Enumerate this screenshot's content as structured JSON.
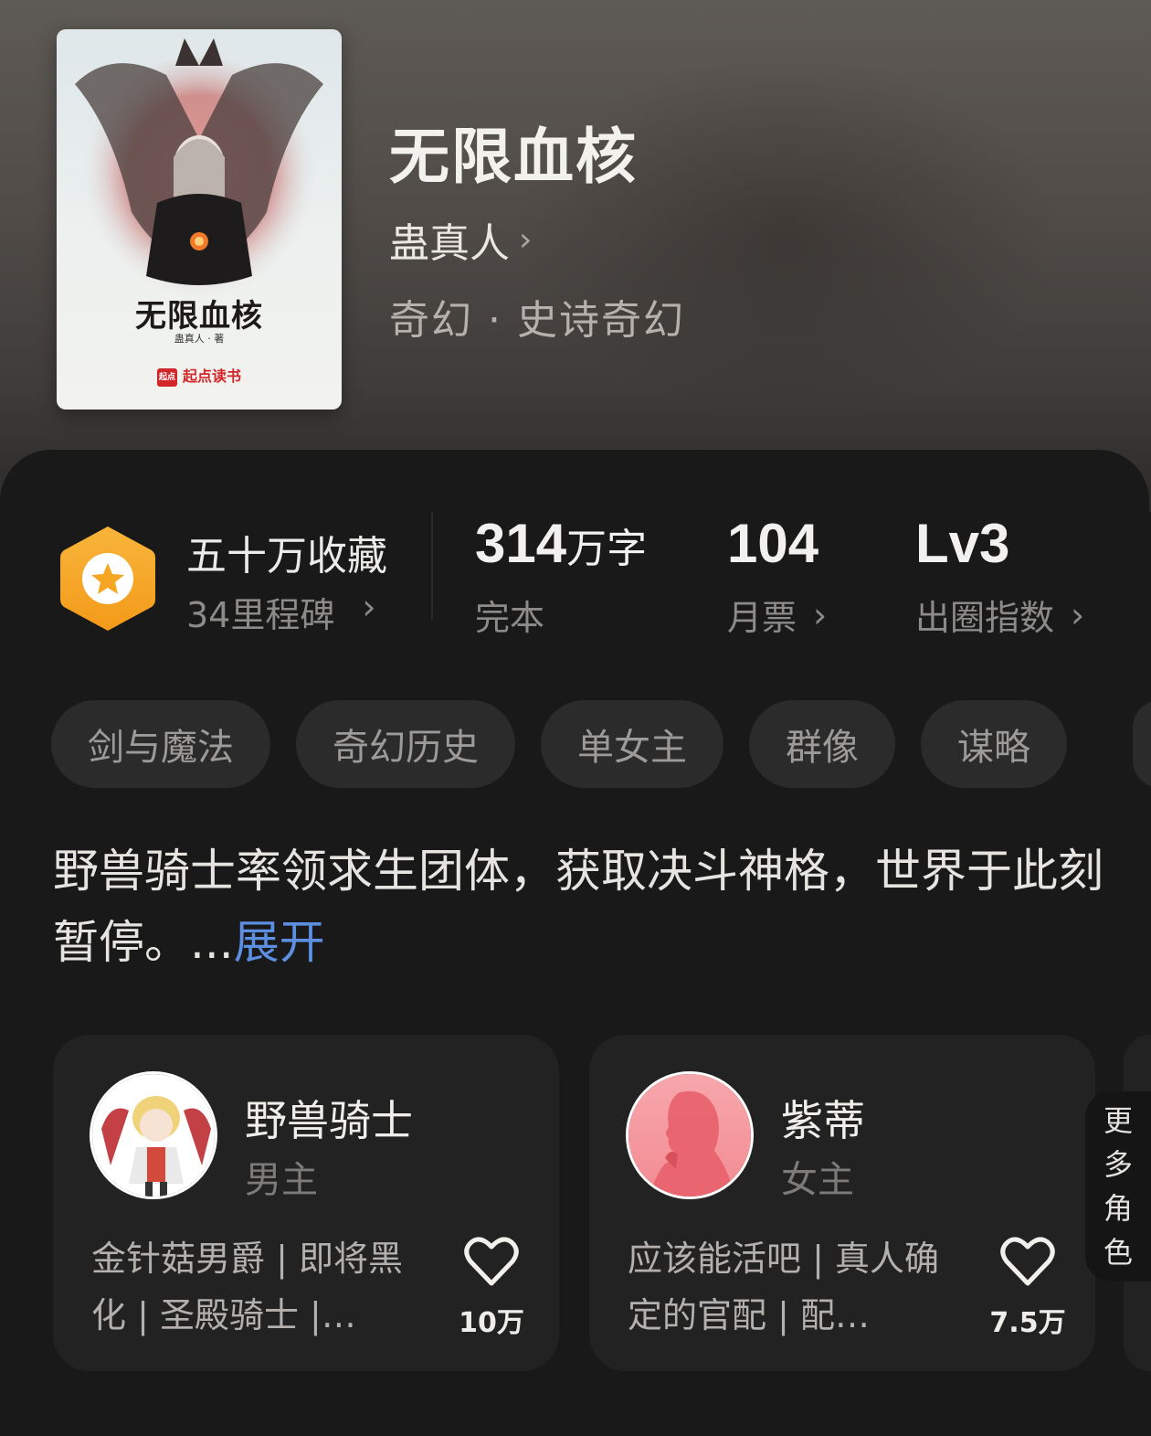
{
  "book": {
    "title": "无限血核",
    "author": "蛊真人",
    "genre": "奇幻 · 史诗奇幻",
    "cover": {
      "title": "无限血核",
      "author_line": "蛊真人 · 著",
      "brand_logo": "起点",
      "brand": "起点读书"
    }
  },
  "stats": {
    "collection": {
      "title": "五十万收藏",
      "subtitle": "34里程碑"
    },
    "words": {
      "value": "314",
      "unit": "万字",
      "label": "完本"
    },
    "monthly_votes": {
      "value": "104",
      "label": "月票"
    },
    "circle_index": {
      "value": "Lv3",
      "label": "出圈指数"
    }
  },
  "tags": [
    "剑与魔法",
    "奇幻历史",
    "单女主",
    "群像",
    "谋略"
  ],
  "description": {
    "text": "野兽骑士率领求生团体，获取决斗神格，世界于此刻暂停。...",
    "expand_label": "展开"
  },
  "characters": [
    {
      "name": "野兽骑士",
      "role": "男主",
      "desc": "金针菇男爵 | 即将黑化 | 圣殿骑士 |…",
      "likes": "10万"
    },
    {
      "name": "紫蒂",
      "role": "女主",
      "desc": "应该能活吧 | 真人确定的官配 | 配…",
      "likes": "7.5万"
    }
  ],
  "more_roles": [
    "更",
    "多",
    "角",
    "色"
  ],
  "colors": {
    "accent_link": "#5c8fe0",
    "badge": "#f5a623",
    "panel_bg": "#191919"
  },
  "icons": {
    "chevron": "chevron-right-icon",
    "badge": "star-hexagon-icon",
    "like": "heart-icon"
  }
}
